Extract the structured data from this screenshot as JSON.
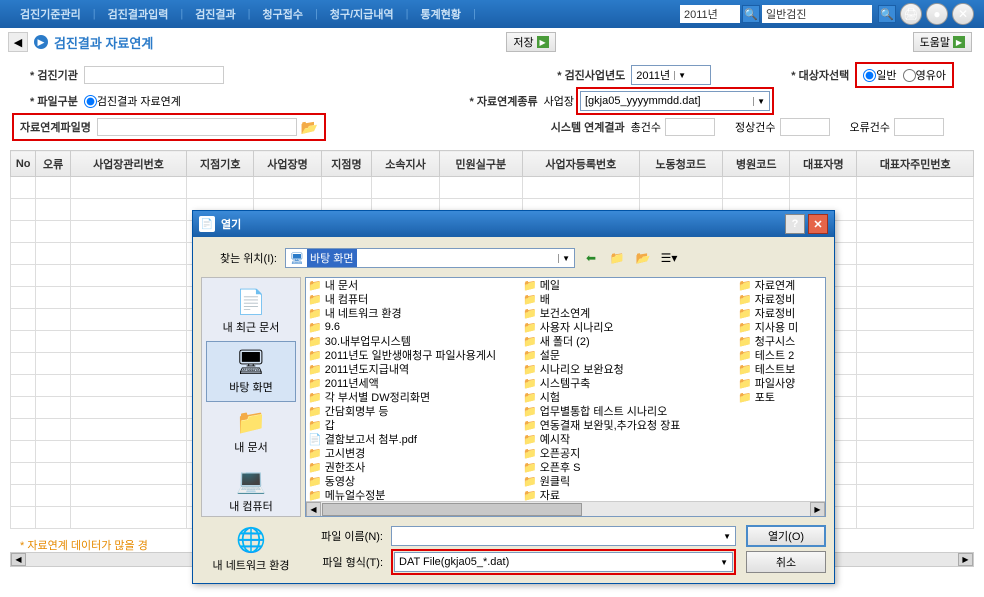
{
  "topbar": {
    "menus": [
      "검진기준관리",
      "검진결과입력",
      "검진결과",
      "청구접수",
      "청구/지급내역",
      "통계현황"
    ],
    "year": "2011년",
    "exam_type": "일반검진"
  },
  "titlerow": {
    "title": "검진결과 자료연계",
    "save_btn": "저장",
    "help_btn": "도움말"
  },
  "form": {
    "r1_inst_label": "검진기관",
    "r1_year_label": "검진사업년도",
    "r1_year_value": "2011년",
    "r1_target_label": "대상자선택",
    "r1_target_opt1": "일반",
    "r1_target_opt2": "영유아",
    "r2_filediv_label": "파일구분",
    "r2_filediv_opt": "검진결과 자료연계",
    "r2_linktype_label": "자료연계종류",
    "r2_linktype_prefix": "사업장",
    "r2_linktype_value": "[gkja05_yyyymmdd.dat]",
    "r3_filename_label": "자료연계파일명",
    "r3_sys_label": "시스템 연계결과",
    "r3_total_label": "총건수",
    "r3_ok_label": "정상건수",
    "r3_err_label": "오류건수"
  },
  "table": {
    "headers": [
      "No",
      "오류",
      "사업장관리번호",
      "지점기호",
      "사업장명",
      "지점명",
      "소속지사",
      "민원실구분",
      "사업자등록번호",
      "노동청코드",
      "병원코드",
      "대표자명",
      "대표자주민번호"
    ]
  },
  "note": "* 자료연계 데이터가 많을 경",
  "dialog": {
    "title": "열기",
    "lookin_label": "찾는 위치(I):",
    "lookin_value": "바탕 화면",
    "sidebar": [
      "내 최근 문서",
      "바탕 화면",
      "내 문서",
      "내 컴퓨터",
      "내 네트워크 환경"
    ],
    "files_col1": [
      "내 문서",
      "내 컴퓨터",
      "내 네트워크 환경",
      "9.6",
      "30.내부업무시스템",
      "2011년도 일반생애청구 파일사용게시",
      "2011년도지급내역",
      "2011년세액",
      "각 부서별 DW정리화면",
      "간담회명부 등",
      "갑",
      "결함보고서 첨부.pdf",
      "고시변경",
      "권한조사"
    ],
    "files_col2": [
      "동영상",
      "메뉴얼수정분",
      "메일",
      "배",
      "보건소연계",
      "사용자 시나리오",
      "새 폴더 (2)",
      "설문",
      "시나리오 보완요청",
      "시스템구축",
      "시험",
      "업무별통합 테스트 시나리오",
      "연동결재 보완및,추가요청 장표",
      "예시작"
    ],
    "files_col3": [
      "오픈공지",
      "오픈후 S",
      "원클릭",
      "자료",
      "자료연계",
      "자료정비",
      "자료정비",
      "지사용 미",
      "청구시스",
      "테스트 2",
      "테스트보",
      "파일사양",
      "포토"
    ],
    "filename_label": "파일 이름(N):",
    "filetype_label": "파일 형식(T):",
    "filetype_value": "DAT File(gkja05_*.dat)",
    "open_btn": "열기(O)",
    "cancel_btn": "취소"
  }
}
